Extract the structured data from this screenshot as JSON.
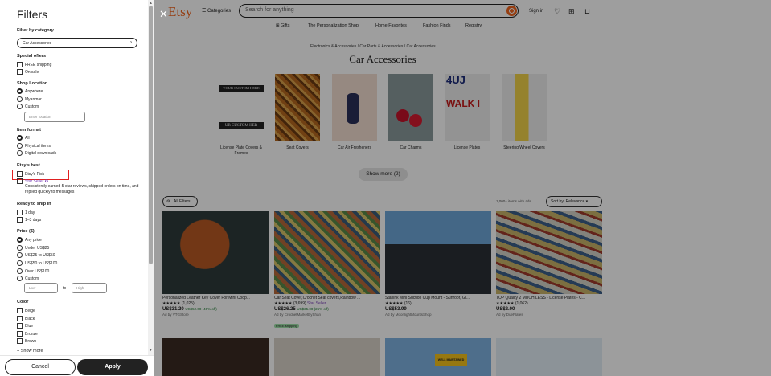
{
  "colors": {
    "brand": "#f1641e",
    "dark": "#222222",
    "highlight": "#e02020"
  },
  "header": {
    "logo": "Etsy",
    "categories_label": "Categories",
    "search_placeholder": "Search for anything",
    "sign_in": "Sign in"
  },
  "nav": [
    "Gifts",
    "The Personalization Shop",
    "Home Favorites",
    "Fashion Finds",
    "Registry"
  ],
  "breadcrumb": "Electronics & Accessories / Car Parts & Accessories / Car Accessories",
  "page_title": "Car Accessories",
  "category_tiles": [
    {
      "label": "License Plate Covers & Frames",
      "image_text_1": "YOUR CUSTOM HERE",
      "image_text_2": "UR CUSTOM HER"
    },
    {
      "label": "Seat Covers"
    },
    {
      "label": "Car Air Fresheners"
    },
    {
      "label": "Car Charms"
    },
    {
      "label": "License Plates",
      "image_text_1": "4UJ",
      "image_text_2": "WALK I"
    },
    {
      "label": "Steering Wheel Covers"
    }
  ],
  "show_more_button": "Show more (2)",
  "all_filters_button": "All Filters",
  "results_count": "1,000+ items with ads",
  "sort_label": "Sort by: Relevance",
  "listings": [
    {
      "title": "Personalized Leather Key Cover For Mini Coop...",
      "rating": "★★★★★",
      "reviews": "(1,025)",
      "price": "US$31.20",
      "orig": "US$52.00 (40% off)",
      "ad": "Ad by VTGStore",
      "star_seller": "",
      "badge": ""
    },
    {
      "title": "Car Seat Cover,Crochet Seat covers,Rainbow ...",
      "rating": "★★★★★",
      "reviews": "(3,699)",
      "price": "US$26.25",
      "orig": "US$35.00 (25% off)",
      "ad": "Ad by CrochetMarketByShan",
      "star_seller": "Star Seller",
      "badge": "FREE shipping"
    },
    {
      "title": "Starlink Mini Suction Cup Mount - Sunroof, Gl...",
      "rating": "★★★★★",
      "reviews": "(16)",
      "price": "US$53.99",
      "orig": "",
      "ad": "Ad by MoonlightMountsShop",
      "star_seller": "",
      "badge": ""
    },
    {
      "title": "TOP Quality 2 MUCH LESS - License Plates - C...",
      "rating": "★★★★★",
      "reviews": "(1,062)",
      "price": "US$2.00",
      "orig": "",
      "ad": "Ad by DuePlates",
      "star_seller": "",
      "badge": ""
    }
  ],
  "second_row_sign": "WELL MAINTAINED",
  "filters": {
    "title": "Filters",
    "category_heading": "Filter by category",
    "category_value": "Car Accessories",
    "special_heading": "Special offers",
    "special": [
      "FREE shipping",
      "On sale"
    ],
    "location_heading": "Shop Location",
    "locations": [
      "Anywhere",
      "Myanmar",
      "Custom"
    ],
    "location_placeholder": "Enter location",
    "format_heading": "Item format",
    "formats": [
      "All",
      "Physical items",
      "Digital downloads"
    ],
    "best_heading": "Etsy's best",
    "best": [
      "Etsy's Pick",
      "Star Seller"
    ],
    "star_seller_note": "Consistently earned 5-star reviews, shipped orders on time, and replied quickly to messages",
    "ready_heading": "Ready to ship in",
    "ready": [
      "1 day",
      "1–3 days"
    ],
    "price_heading": "Price ($)",
    "prices": [
      "Any price",
      "Under US$25",
      "US$25 to US$50",
      "US$50 to US$100",
      "Over US$100",
      "Custom"
    ],
    "low_placeholder": "Low",
    "to_label": "to",
    "high_placeholder": "High",
    "color_heading": "Color",
    "colors": [
      "Beige",
      "Black",
      "Blue",
      "Bronze",
      "Brown"
    ],
    "show_more": "+ Show more",
    "cancel": "Cancel",
    "apply": "Apply"
  }
}
